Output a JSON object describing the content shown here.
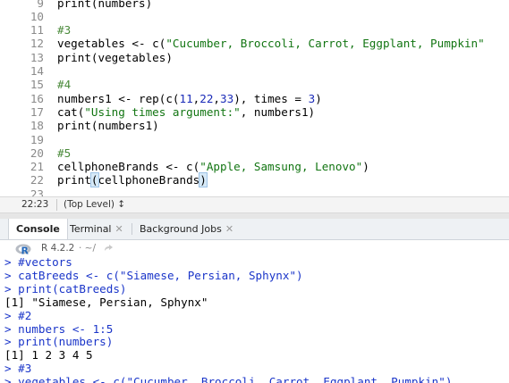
{
  "editor": {
    "lines": [
      {
        "num": "9",
        "tokens": [
          {
            "t": "print(numbers)",
            "c": "kw"
          }
        ]
      },
      {
        "num": "10",
        "tokens": []
      },
      {
        "num": "11",
        "tokens": [
          {
            "t": "#3",
            "c": "cm"
          }
        ]
      },
      {
        "num": "12",
        "tokens": [
          {
            "t": "vegetables <- c(",
            "c": "kw"
          },
          {
            "t": "\"Cucumber, Broccoli, Carrot, Eggplant, Pumpkin\"",
            "c": "str"
          }
        ]
      },
      {
        "num": "13",
        "tokens": [
          {
            "t": "print(vegetables)",
            "c": "kw"
          }
        ]
      },
      {
        "num": "14",
        "tokens": []
      },
      {
        "num": "15",
        "tokens": [
          {
            "t": "#4",
            "c": "cm"
          }
        ]
      },
      {
        "num": "16",
        "tokens": [
          {
            "t": "numbers1 <- rep(c(",
            "c": "kw"
          },
          {
            "t": "11",
            "c": "num"
          },
          {
            "t": ",",
            "c": "kw"
          },
          {
            "t": "22",
            "c": "num"
          },
          {
            "t": ",",
            "c": "kw"
          },
          {
            "t": "33",
            "c": "num"
          },
          {
            "t": "), times = ",
            "c": "kw"
          },
          {
            "t": "3",
            "c": "num"
          },
          {
            "t": ")",
            "c": "kw"
          }
        ]
      },
      {
        "num": "17",
        "tokens": [
          {
            "t": "cat(",
            "c": "kw"
          },
          {
            "t": "\"Using times argument:\"",
            "c": "str"
          },
          {
            "t": ", numbers1)",
            "c": "kw"
          }
        ]
      },
      {
        "num": "18",
        "tokens": [
          {
            "t": "print(numbers1)",
            "c": "kw"
          }
        ]
      },
      {
        "num": "19",
        "tokens": []
      },
      {
        "num": "20",
        "tokens": [
          {
            "t": "#5",
            "c": "cm"
          }
        ]
      },
      {
        "num": "21",
        "tokens": [
          {
            "t": "cellphoneBrands <- c(",
            "c": "kw"
          },
          {
            "t": "\"Apple, Samsung, Lenovo\"",
            "c": "str"
          },
          {
            "t": ")",
            "c": "kw"
          }
        ]
      },
      {
        "num": "22",
        "tokens": [
          {
            "t": "print",
            "c": "kw"
          },
          {
            "t": "(",
            "c": "cursor-paren"
          },
          {
            "t": "cellphoneBrands",
            "c": "kw"
          },
          {
            "t": ")",
            "c": "cursor-paren"
          }
        ]
      },
      {
        "num": "23",
        "tokens": []
      }
    ]
  },
  "status": {
    "position": "22:23",
    "scope": "(Top Level) ↕"
  },
  "tabs": [
    {
      "label": "Console",
      "closable": false,
      "active": true
    },
    {
      "label": "Terminal",
      "closable": true,
      "active": false
    },
    {
      "label": "Background Jobs",
      "closable": true,
      "active": false
    }
  ],
  "console_bar": {
    "version": "R 4.2.2",
    "path": "· ~/"
  },
  "console": [
    {
      "t": "> #vectors",
      "c": "con-cmd"
    },
    {
      "t": "> catBreeds <- c(\"Siamese, Persian, Sphynx\")",
      "c": "con-cmd"
    },
    {
      "t": "> print(catBreeds)",
      "c": "con-cmd"
    },
    {
      "t": "[1] \"Siamese, Persian, Sphynx\"",
      "c": "con-out"
    },
    {
      "t": "> #2",
      "c": "con-cmd"
    },
    {
      "t": "> numbers <- 1:5",
      "c": "con-cmd"
    },
    {
      "t": "> print(numbers)",
      "c": "con-cmd"
    },
    {
      "t": "[1] 1 2 3 4 5",
      "c": "con-out"
    },
    {
      "t": "> #3",
      "c": "con-cmd"
    },
    {
      "t": "> vegetables <- c(\"Cucumber, Broccoli, Carrot, Eggplant, Pumpkin\")",
      "c": "con-cmd"
    }
  ],
  "colors": {
    "comment": "#4a8a3a",
    "string": "#127512",
    "number": "#1a2bb8",
    "console_command": "#1a35c9",
    "r_logo": "#2266b8"
  },
  "icons": {
    "r_logo": "r-logo-icon",
    "go_to_dir": "arrow-icon"
  }
}
